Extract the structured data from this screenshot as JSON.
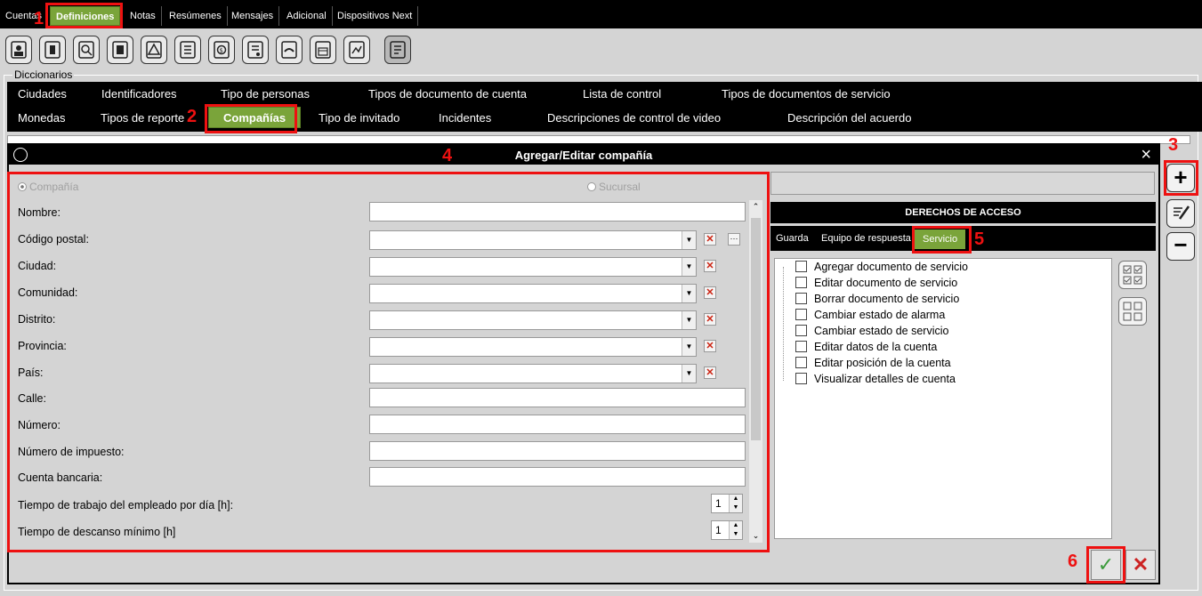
{
  "menu": {
    "tabs": [
      "Cuentas",
      "Definiciones",
      "Notas",
      "Resúmenes",
      "Mensajes",
      "Adicional",
      "Dispositivos Next"
    ]
  },
  "toolbar": {
    "icons": [
      "person-card-icon",
      "badge-icon",
      "search-doc-icon",
      "id-card-icon",
      "warning-doc-icon",
      "list-doc-icon",
      "money-doc-icon",
      "report-doc-icon",
      "handshake-doc-icon",
      "calendar-doc-icon",
      "map-doc-icon",
      "document-icon"
    ]
  },
  "dictionaries": {
    "label": "Diccionarios",
    "row1": [
      "Ciudades",
      "Identificadores",
      "Tipo de personas",
      "Tipos de documento de cuenta",
      "Lista de control",
      "Tipos de documentos de servicio"
    ],
    "row2": [
      "Monedas",
      "Tipos de reporte",
      "Compañías",
      "Tipo de invitado",
      "Incidentes",
      "Descripciones de control de video",
      "Descripción del acuerdo"
    ],
    "active": "Compañías"
  },
  "dialog": {
    "title": "Agregar/Editar compañía",
    "close": "×",
    "radio_company": "Compañía",
    "radio_branch": "Sucursal",
    "fields": {
      "nombre": "Nombre:",
      "codigo_postal": "Código postal:",
      "ciudad": "Ciudad:",
      "comunidad": "Comunidad:",
      "distrito": "Distrito:",
      "provincia": "Provincia:",
      "pais": "País:",
      "calle": "Calle:",
      "numero": "Número:",
      "numero_impuesto": "Número de impuesto:",
      "cuenta_bancaria": "Cuenta bancaria:",
      "tiempo_trabajo": "Tiempo de trabajo del empleado por día [h]:",
      "tiempo_descanso": "Tiempo de descanso mínimo [h]"
    },
    "spin_values": {
      "tiempo_trabajo": "1",
      "tiempo_descanso": "1"
    }
  },
  "access_rights": {
    "header": "DERECHOS DE ACCESO",
    "tabs": [
      "Guarda",
      "Equipo de respuesta",
      "Servicio"
    ],
    "active_tab": "Servicio",
    "items": [
      "Agregar documento de servicio",
      "Editar documento de servicio",
      "Borrar documento de servicio",
      "Cambiar estado de alarma",
      "Cambiar estado de servicio",
      "Editar datos de la cuenta",
      "Editar posición de la cuenta",
      "Visualizar detalles de cuenta"
    ]
  },
  "annotations": [
    "1",
    "2",
    "3",
    "4",
    "5",
    "6"
  ],
  "colors": {
    "accent_green": "#7aa43a",
    "annotation_red": "#e11111"
  }
}
